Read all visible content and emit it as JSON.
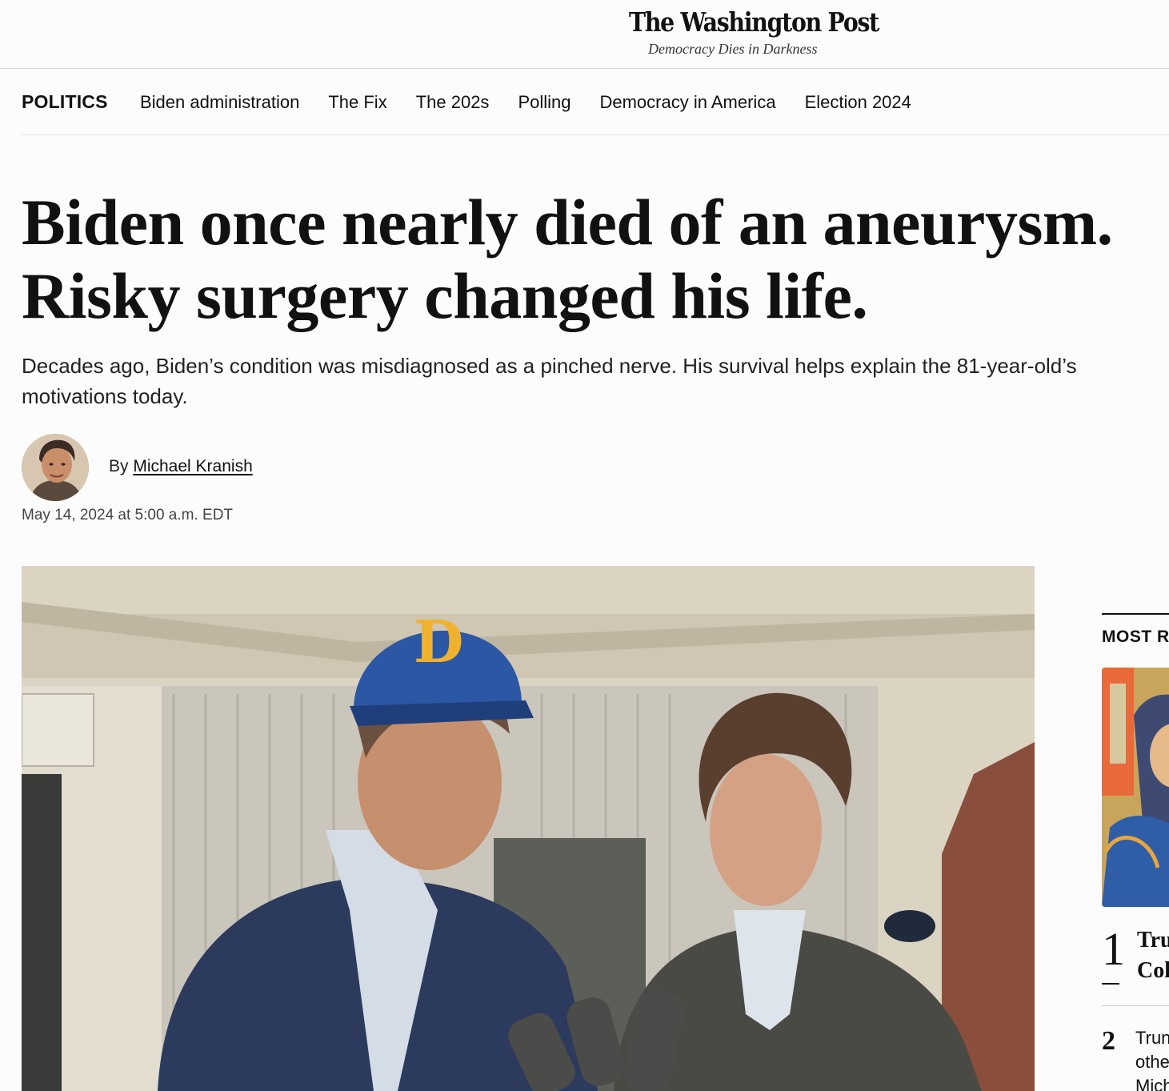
{
  "masthead": {
    "logo": "The Washington Post",
    "tagline": "Democracy Dies in Darkness"
  },
  "subnav": {
    "section": "POLITICS",
    "links": [
      "Biden administration",
      "The Fix",
      "The 202s",
      "Polling",
      "Democracy in America",
      "Election 2024"
    ]
  },
  "article": {
    "headline_line1": "Biden once nearly died of an aneurysm.",
    "headline_line2": "Risky surgery changed his life.",
    "dek": "Decades ago, Biden’s condition was misdiagnosed as a pinched nerve. His survival helps explain the 81-year-old’s motivations today.",
    "byline_prefix": "By ",
    "author": "Michael Kranish",
    "timestamp": "May 14, 2024 at 5:00 a.m. EDT"
  },
  "rail": {
    "title": "MOST R",
    "items": [
      {
        "rank": "1",
        "title_line1": "Tru",
        "title_line2": "Col"
      },
      {
        "rank": "2",
        "title_line1": "Trun",
        "title_line2": "othe",
        "title_line3": "Mich"
      }
    ]
  },
  "colors": {
    "text": "#111111",
    "background": "#fcfcfc",
    "divider": "#dcdcdc"
  }
}
